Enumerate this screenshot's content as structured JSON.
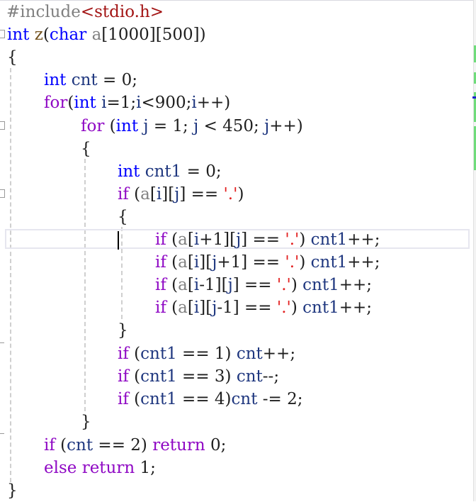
{
  "editor": {
    "language": "C",
    "lines": {
      "l1": {
        "a": "#include",
        "b": "<stdio.h>"
      },
      "l2": {
        "a": "int",
        "b": " ",
        "c": "z",
        "d": "(",
        "e": "char",
        "f": " ",
        "g": "a",
        "h": "[1000][500])"
      },
      "l3": {
        "a": "{"
      },
      "l4": {
        "a": "int",
        "b": " ",
        "c": "cnt",
        "d": " = 0;"
      },
      "l5": {
        "a": "for",
        "b": "(",
        "c": "int",
        "d": " ",
        "e": "i",
        "f": "=1;",
        "g": "i",
        "h": "<900;",
        "i": "i",
        "j": "++)"
      },
      "l6": {
        "a": "for",
        "b": " (",
        "c": "int",
        "d": " ",
        "e": "j",
        "f": " = 1; ",
        "g": "j",
        "h": " < 450; ",
        "i": "j",
        "j": "++)"
      },
      "l7": {
        "a": "{"
      },
      "l8": {
        "a": "int",
        "b": " ",
        "c": "cnt1",
        "d": " = 0;"
      },
      "l9": {
        "a": "if",
        "b": " (",
        "c": "a",
        "d": "[",
        "e": "i",
        "f": "][",
        "g": "j",
        "h": "] == ",
        "i": "'.'",
        "j": ")"
      },
      "l10": {
        "a": "{"
      },
      "l11": {
        "a": "if",
        "b": " (",
        "c": "a",
        "d": "[",
        "e": "i",
        "f": "+1][",
        "g": "j",
        "h": "] == ",
        "i": "'.'",
        "j": ") ",
        "k": "cnt1",
        "l": "++;"
      },
      "l12": {
        "a": "if",
        "b": " (",
        "c": "a",
        "d": "[",
        "e": "i",
        "f": "][",
        "g": "j",
        "h": "+1] == ",
        "i": "'.'",
        "j": ") ",
        "k": "cnt1",
        "l": "++;"
      },
      "l13": {
        "a": "if",
        "b": " (",
        "c": "a",
        "d": "[",
        "e": "i",
        "f": "-1][",
        "g": "j",
        "h": "] == ",
        "i": "'.'",
        "j": ") ",
        "k": "cnt1",
        "l": "++;"
      },
      "l14": {
        "a": "if",
        "b": " (",
        "c": "a",
        "d": "[",
        "e": "i",
        "f": "][",
        "g": "j",
        "h": "-1] == ",
        "i": "'.'",
        "j": ") ",
        "k": "cnt1",
        "l": "++;"
      },
      "l15": {
        "a": "}"
      },
      "l16": {
        "a": "if",
        "b": " (",
        "c": "cnt1",
        "d": " == 1) ",
        "e": "cnt",
        "f": "++;"
      },
      "l17": {
        "a": "if",
        "b": " (",
        "c": "cnt1",
        "d": " == 3) ",
        "e": "cnt",
        "f": "--;"
      },
      "l18": {
        "a": "if",
        "b": " (",
        "c": "cnt1",
        "d": " == 4)",
        "e": "cnt",
        "f": " -= 2;"
      },
      "l19": {
        "a": "}"
      },
      "l20": {
        "a": "if",
        "b": " (",
        "c": "cnt",
        "d": " == 2) ",
        "e": "return",
        "f": " 0;"
      },
      "l21": {
        "a": "else",
        "b": " ",
        "c": "return",
        "d": " 1;"
      },
      "l22": {
        "a": "}"
      }
    }
  },
  "colors": {
    "keyword": "#0000ff",
    "control": "#8f08c4",
    "string": "#a31515",
    "char_literal": "#e21f1f",
    "variable": "#1f377f",
    "parameter": "#808080",
    "function": "#74531f",
    "change_marker": "#6fdc7a"
  }
}
